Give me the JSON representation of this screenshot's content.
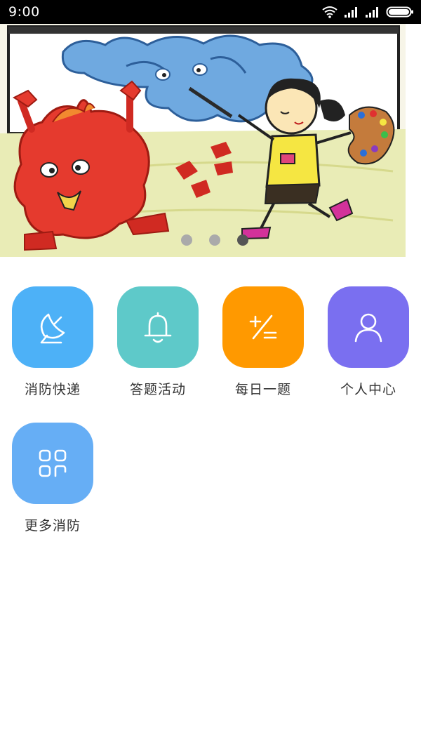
{
  "status_bar": {
    "time": "9:00"
  },
  "banner": {
    "slide_count": 3,
    "active_slide": 3
  },
  "menu": {
    "items": [
      {
        "label": "消防快递",
        "icon": "satellite-dish-icon",
        "color": "#4db1f7"
      },
      {
        "label": "答题活动",
        "icon": "bell-icon",
        "color": "#5ec9c9"
      },
      {
        "label": "每日一题",
        "icon": "plus-minus-equals-icon",
        "color": "#ff9900"
      },
      {
        "label": "个人中心",
        "icon": "person-icon",
        "color": "#7a6ff0"
      },
      {
        "label": "更多消防",
        "icon": "grid-apps-icon",
        "color": "#66aef5"
      }
    ]
  }
}
